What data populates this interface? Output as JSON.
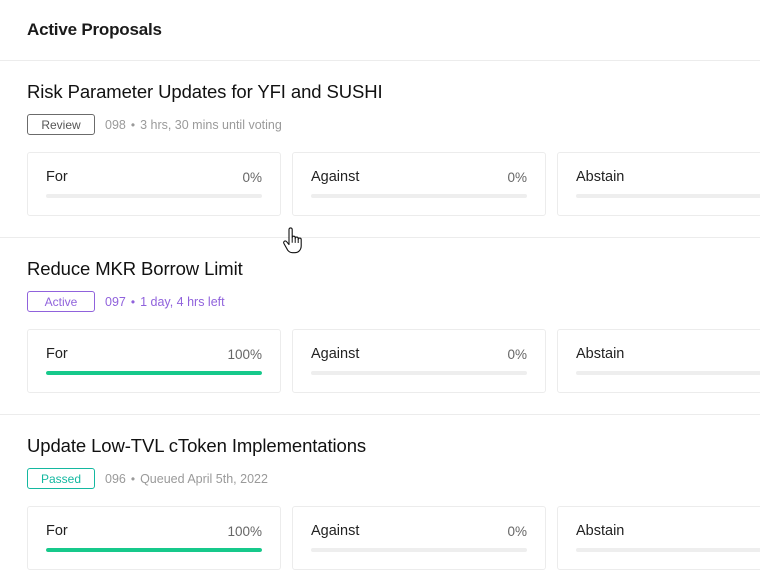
{
  "header": {
    "title": "Active Proposals"
  },
  "proposals": [
    {
      "title": "Risk Parameter Updates for YFI and SUSHI",
      "badge": "Review",
      "badge_kind": "review",
      "id": "098",
      "dot": "•",
      "status": "3 hrs, 30 mins until voting",
      "votes": [
        {
          "label": "For",
          "pct": "0%",
          "value": 0
        },
        {
          "label": "Against",
          "pct": "0%",
          "value": 0
        },
        {
          "label": "Abstain",
          "pct": "",
          "value": 0
        }
      ]
    },
    {
      "title": "Reduce MKR Borrow Limit",
      "badge": "Active",
      "badge_kind": "active",
      "id": "097",
      "dot": "•",
      "status": "1 day, 4 hrs left",
      "votes": [
        {
          "label": "For",
          "pct": "100%",
          "value": 100
        },
        {
          "label": "Against",
          "pct": "0%",
          "value": 0
        },
        {
          "label": "Abstain",
          "pct": "",
          "value": 0
        }
      ]
    },
    {
      "title": "Update Low-TVL cToken Implementations",
      "badge": "Passed",
      "badge_kind": "passed",
      "id": "096",
      "dot": "•",
      "status": "Queued April 5th, 2022",
      "votes": [
        {
          "label": "For",
          "pct": "100%",
          "value": 100
        },
        {
          "label": "Against",
          "pct": "0%",
          "value": 0
        },
        {
          "label": "Abstain",
          "pct": "",
          "value": 0
        }
      ]
    }
  ],
  "colors": {
    "review": "#6b6b6b",
    "active": "#9062dc",
    "passed": "#14b8a0",
    "for_bar": "#16c98b",
    "track": "#eeeeee"
  },
  "icons": {
    "cursor": "hand-pointer-icon"
  }
}
